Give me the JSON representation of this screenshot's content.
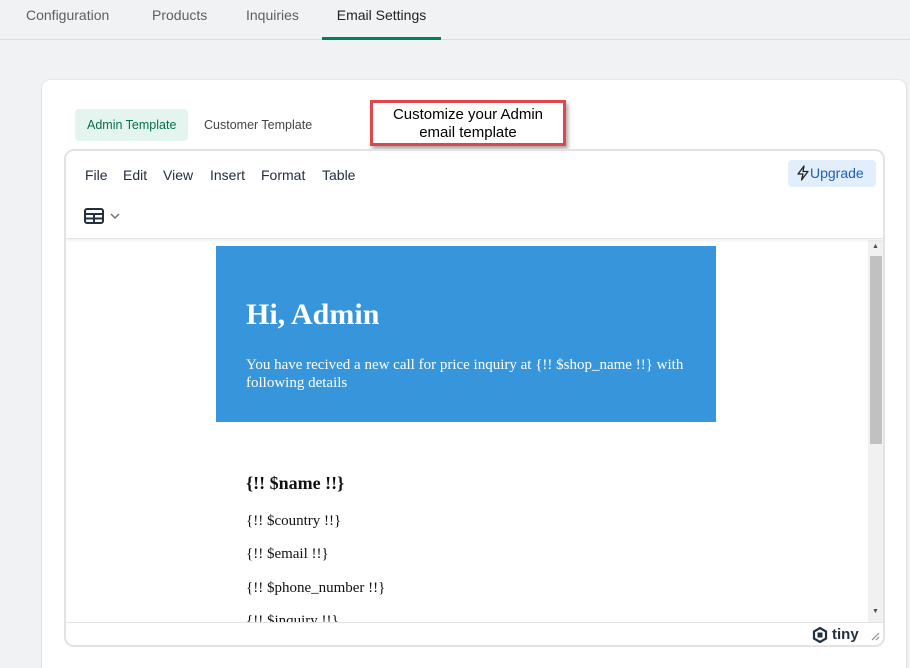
{
  "tabs": [
    {
      "label": "Configuration",
      "active": false
    },
    {
      "label": "Products",
      "active": false
    },
    {
      "label": "Inquiries",
      "active": false
    },
    {
      "label": "Email Settings",
      "active": true
    }
  ],
  "template_switch": {
    "admin_label": "Admin Template",
    "customer_label": "Customer Template",
    "active": "admin"
  },
  "callout": {
    "text": "Customize your Admin email template"
  },
  "editor": {
    "menu": [
      "File",
      "Edit",
      "View",
      "Insert",
      "Format",
      "Table"
    ],
    "upgrade_label": "Upgrade",
    "toolbar_icons": [
      "table-icon",
      "chevron-down-icon"
    ],
    "brand": "tiny"
  },
  "email": {
    "banner_color": "#3796db",
    "heading": "Hi, Admin",
    "intro": "You have recived a new call  for price inquiry at {!! $shop_name !!} with following details",
    "fields": [
      "{!! $name !!}",
      "{!! $country !!}",
      "{!! $email !!}",
      "{!! $phone_number !!}",
      "{!! $inquiry !!}"
    ]
  },
  "colors": {
    "accent": "#008060",
    "callout_border": "#e0474c",
    "upgrade_bg": "#e3eefc"
  }
}
